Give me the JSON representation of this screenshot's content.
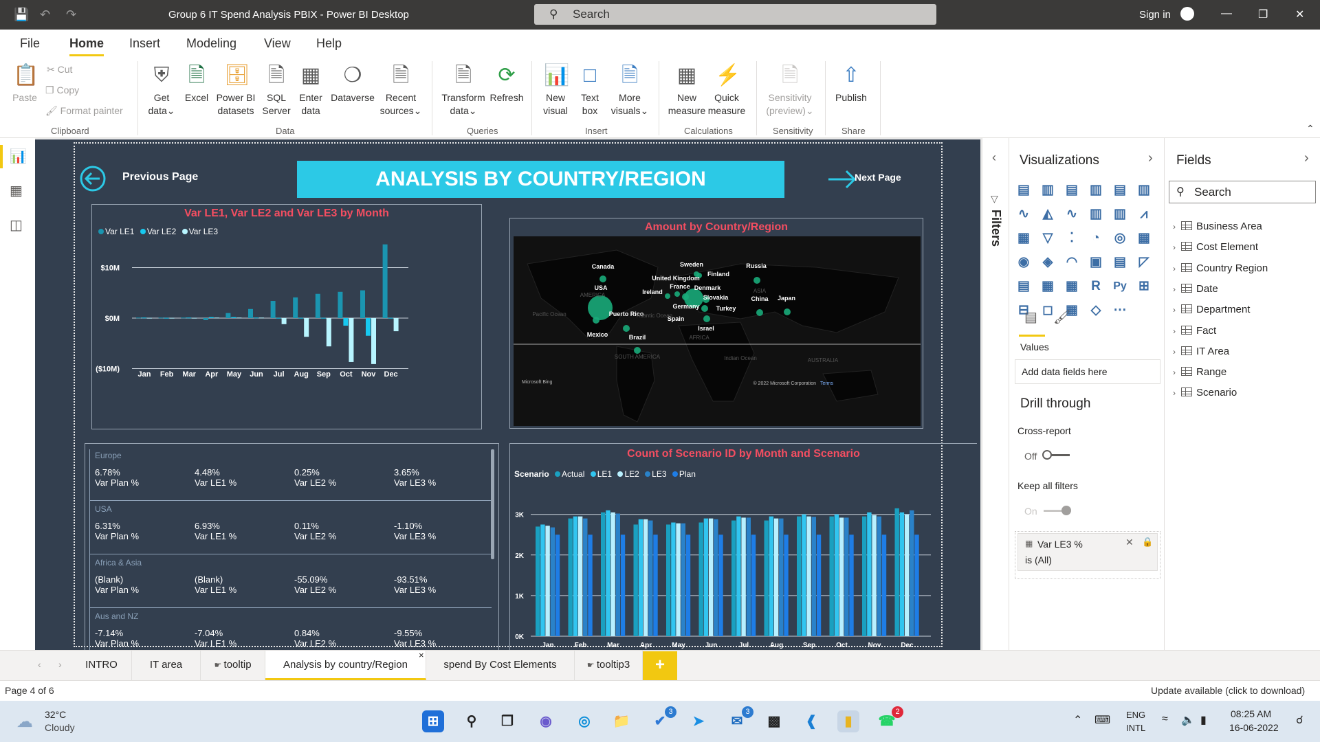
{
  "window": {
    "title": "Group 6 IT Spend Analysis PBIX - Power BI Desktop",
    "search_placeholder": "Search",
    "signin": "Sign in"
  },
  "menu": {
    "items": [
      "File",
      "Home",
      "Insert",
      "Modeling",
      "View",
      "Help"
    ]
  },
  "ribbon": {
    "clipboard": {
      "paste": "Paste",
      "cut": "Cut",
      "copy": "Copy",
      "format_painter": "Format painter",
      "group": "Clipboard"
    },
    "data": {
      "get_data": [
        "Get",
        "data"
      ],
      "excel": "Excel",
      "pbi_datasets": [
        "Power BI",
        "datasets"
      ],
      "sql": [
        "SQL",
        "Server"
      ],
      "enter": [
        "Enter",
        "data"
      ],
      "dataverse": "Dataverse",
      "recent": [
        "Recent",
        "sources"
      ],
      "group": "Data"
    },
    "queries": {
      "transform": [
        "Transform",
        "data"
      ],
      "refresh": "Refresh",
      "group": "Queries"
    },
    "insert": {
      "new_visual": [
        "New",
        "visual"
      ],
      "text_box": [
        "Text",
        "box"
      ],
      "more": [
        "More",
        "visuals"
      ],
      "group": "Insert"
    },
    "calculations": {
      "new_measure": [
        "New",
        "measure"
      ],
      "quick_measure": [
        "Quick",
        "measure"
      ],
      "group": "Calculations"
    },
    "sensitivity": {
      "label": [
        "Sensitivity",
        "(preview)"
      ],
      "group": "Sensitivity"
    },
    "share": {
      "publish": "Publish",
      "group": "Share"
    }
  },
  "report": {
    "prev": "Previous Page",
    "next": "Next Page",
    "title": "ANALYSIS BY COUNTRY/REGION",
    "colors": {
      "bg": "#333f4f",
      "banner": "#2cc9e6",
      "title_red": "#f44e61"
    }
  },
  "chart_data": [
    {
      "type": "bar",
      "title": "Var LE1, Var LE2 and Var LE3 by Month",
      "categories": [
        "Jan",
        "Feb",
        "Mar",
        "Apr",
        "May",
        "Jun",
        "Jul",
        "Aug",
        "Sep",
        "Oct",
        "Nov",
        "Dec"
      ],
      "ytick_labels": [
        "$10M",
        "$0M",
        "($10M)"
      ],
      "ylim": [
        -10.5,
        15
      ],
      "series": [
        {
          "name": "Var LE1",
          "color": "#1b95b0",
          "values": [
            0.1,
            0.1,
            0.1,
            -0.4,
            1.0,
            1.8,
            3.4,
            4.1,
            4.8,
            5.2,
            5.5,
            14.6
          ]
        },
        {
          "name": "Var LE2",
          "color": "#17c9f0",
          "values": [
            0.1,
            0.05,
            0.1,
            0.2,
            0.2,
            0.1,
            0.05,
            0.05,
            0.05,
            -1.5,
            -3.5,
            0.05
          ]
        },
        {
          "name": "Var LE3",
          "color": "#b8f5ff",
          "values": [
            0.05,
            0.05,
            0.05,
            0.1,
            0.1,
            0.1,
            -1.2,
            -3.7,
            -5.6,
            -8.7,
            -9.1,
            -2.6
          ]
        }
      ]
    },
    {
      "type": "bar",
      "title": "Count of Scenario ID by Month and Scenario",
      "legend_title": "Scenario",
      "categories": [
        "Jan",
        "Feb",
        "Mar",
        "Apr",
        "May",
        "Jun",
        "Jul",
        "Aug",
        "Sep",
        "Oct",
        "Nov",
        "Dec"
      ],
      "ytick_labels": [
        "3K",
        "2K",
        "1K",
        "0K"
      ],
      "ylim": [
        0,
        3300
      ],
      "series": [
        {
          "name": "Actual",
          "color": "#1aa0c0",
          "values": [
            2700,
            2900,
            3050,
            2750,
            2750,
            2800,
            2850,
            2850,
            2950,
            2950,
            2950,
            3150
          ]
        },
        {
          "name": "LE1",
          "color": "#31c5f0",
          "values": [
            2750,
            2950,
            3100,
            2880,
            2800,
            2900,
            2950,
            2950,
            3000,
            3000,
            3050,
            3050
          ]
        },
        {
          "name": "LE2",
          "color": "#b8f0ff",
          "values": [
            2720,
            2950,
            3050,
            2880,
            2780,
            2900,
            2920,
            2900,
            2950,
            2920,
            2980,
            3000
          ]
        },
        {
          "name": "LE3",
          "color": "#2a82c9",
          "values": [
            2680,
            2900,
            3020,
            2850,
            2780,
            2880,
            2920,
            2900,
            2940,
            2920,
            2950,
            3100
          ]
        },
        {
          "name": "Plan",
          "color": "#1e7de6",
          "values": [
            2500,
            2500,
            2500,
            2500,
            2500,
            2500,
            2500,
            2500,
            2500,
            2500,
            2500,
            2500
          ]
        }
      ]
    }
  ],
  "map": {
    "title": "Amount by Country/Region",
    "credit": "© 2022 Microsoft Corporation",
    "terms": "Terms",
    "bing": "Microsoft Bing",
    "labels": [
      "Canada",
      "USA",
      "Mexico",
      "Puerto Rico",
      "Brazil",
      "Ireland",
      "United Kingdom",
      "Sweden",
      "Finland",
      "France",
      "Denmark",
      "Slovakia",
      "Germany",
      "Spain",
      "Turkey",
      "Israel",
      "Russia",
      "China",
      "Japan"
    ],
    "regions": [
      "AMERICA",
      "SOUTH AMERICA",
      "AFRICA",
      "ASIA",
      "AUSTRALIA",
      "Pacific Ocean",
      "Indian Ocean",
      "Atlantic Ocean"
    ]
  },
  "matrix": {
    "segments": [
      {
        "name": "Europe",
        "values": [
          "6.78%",
          "4.48%",
          "0.25%",
          "3.65%"
        ]
      },
      {
        "name": "USA",
        "values": [
          "6.31%",
          "6.93%",
          "0.11%",
          "-1.10%"
        ]
      },
      {
        "name": "Africa & Asia",
        "values": [
          "(Blank)",
          "(Blank)",
          "-55.09%",
          "-93.51%"
        ]
      },
      {
        "name": "Aus and NZ",
        "values": [
          "-7.14%",
          "-7.04%",
          "0.84%",
          "-9.55%"
        ]
      }
    ],
    "measures": [
      "Var Plan %",
      "Var LE1 %",
      "Var LE2 %",
      "Var LE3 %"
    ]
  },
  "panes": {
    "filters": "Filters",
    "visualizations": "Visualizations",
    "values": "Values",
    "add_fields": "Add data fields here",
    "drill_through": "Drill through",
    "cross_report": "Cross-report",
    "off": "Off",
    "keep_filters": "Keep all filters",
    "on": "On",
    "filter_card": {
      "name": "Var LE3 %",
      "value": "is (All)"
    },
    "fields": "Fields",
    "fields_search": "Search",
    "tables": [
      "Business Area",
      "Cost Element",
      "Country Region",
      "Date",
      "Department",
      "Fact",
      "IT Area",
      "Range",
      "Scenario"
    ]
  },
  "tabs": [
    "INTRO",
    "IT area",
    "tooltip",
    "Analysis by country/Region",
    "spend By Cost Elements",
    "tooltip3"
  ],
  "status": {
    "page": "Page 4 of 6",
    "update": "Update available (click to download)"
  },
  "taskbar": {
    "temp": "32°C",
    "weather": "Cloudy",
    "lang1": "ENG",
    "lang2": "INTL",
    "time": "08:25 AM",
    "date": "16-06-2022",
    "badges": [
      "3",
      "3",
      "2"
    ]
  }
}
